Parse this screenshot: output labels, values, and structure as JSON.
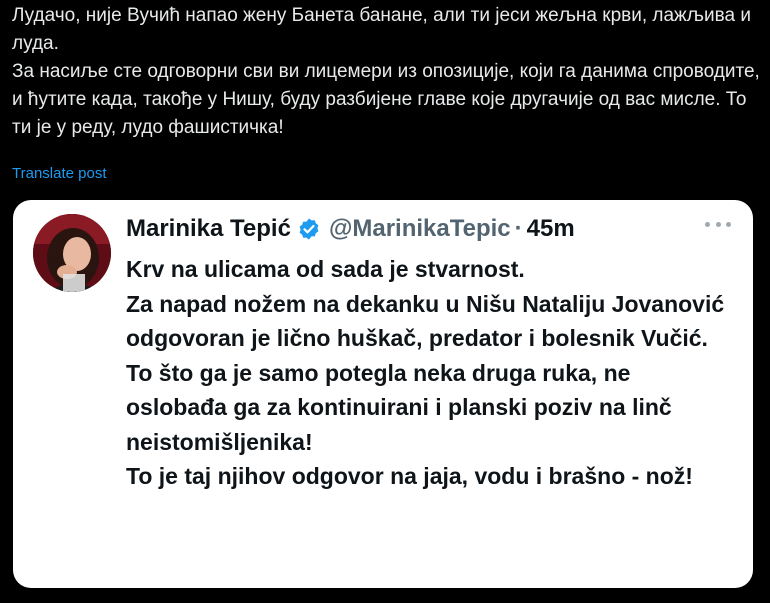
{
  "post": {
    "text": "Лудачо, није Вучић напао жену Банета банане, али ти јеси жељна крви, лажљива и луда.\nЗа насиље сте одговорни сви ви лицемери из опозиције, који га данима спроводите, и ћутите када, такође у Нишу, буду разбијене главе које другачије од вас мисле. То ти је у реду, лудо фашистичка!",
    "translate_label": "Translate post"
  },
  "quote": {
    "author_name": "Marinika Tepić",
    "handle": "@MarinikaTepic",
    "separator": "·",
    "time": "45m",
    "text": "Krv na ulicama od sada je stvarnost.\nZa napad nožem na dekanku u Nišu Nataliju Jovanović odgovoran je lično huškač, predator i bolesnik Vučić.\nTo što ga je samo potegla neka druga ruka, ne oslobađa ga za kontinuirani i planski poziv na linč neistomišljenika!\nTo je taj njihov odgovor na jaja, vodu i brašno - nož!"
  },
  "colors": {
    "background": "#000000",
    "text_light": "#e7e9ea",
    "link": "#1d9bf0",
    "card_bg": "#ffffff",
    "verified": "#1d9bf0",
    "handle": "#536471"
  },
  "icons": {
    "verified": "verified-badge-icon",
    "more": "more-horizontal-icon"
  }
}
